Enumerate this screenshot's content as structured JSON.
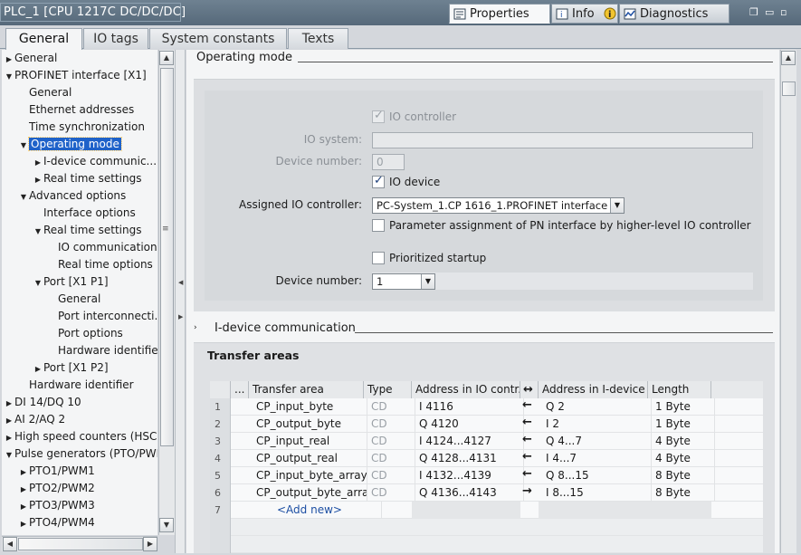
{
  "window": {
    "title": "PLC_1 [CPU 1217C DC/DC/DC]"
  },
  "inspector_tabs": [
    {
      "label": "Properties",
      "icon": "properties-icon",
      "active": true
    },
    {
      "label": "Info",
      "icon": "info-icon",
      "active": false
    },
    {
      "label": "Diagnostics",
      "icon": "diagnostics-icon",
      "active": false
    }
  ],
  "tabs": [
    {
      "label": "General",
      "active": true
    },
    {
      "label": "IO tags",
      "active": false
    },
    {
      "label": "System constants",
      "active": false
    },
    {
      "label": "Texts",
      "active": false
    }
  ],
  "nav": [
    {
      "label": "General",
      "level": 0,
      "arrow": "collapsed"
    },
    {
      "label": "PROFINET interface [X1]",
      "level": 0,
      "arrow": "expanded"
    },
    {
      "label": "General",
      "level": 1,
      "arrow": "none"
    },
    {
      "label": "Ethernet addresses",
      "level": 1,
      "arrow": "none"
    },
    {
      "label": "Time synchronization",
      "level": 1,
      "arrow": "none"
    },
    {
      "label": "Operating mode",
      "level": 1,
      "arrow": "expanded",
      "selected": true
    },
    {
      "label": "I-device communic...",
      "level": 2,
      "arrow": "collapsed"
    },
    {
      "label": "Real time settings",
      "level": 2,
      "arrow": "collapsed"
    },
    {
      "label": "Advanced options",
      "level": 1,
      "arrow": "expanded"
    },
    {
      "label": "Interface options",
      "level": 2,
      "arrow": "none"
    },
    {
      "label": "Real time settings",
      "level": 2,
      "arrow": "expanded"
    },
    {
      "label": "IO communication",
      "level": 3,
      "arrow": "none"
    },
    {
      "label": "Real time options",
      "level": 3,
      "arrow": "none"
    },
    {
      "label": "Port [X1 P1]",
      "level": 2,
      "arrow": "expanded"
    },
    {
      "label": "General",
      "level": 3,
      "arrow": "none"
    },
    {
      "label": "Port interconnecti...",
      "level": 3,
      "arrow": "none"
    },
    {
      "label": "Port options",
      "level": 3,
      "arrow": "none"
    },
    {
      "label": "Hardware identifier",
      "level": 3,
      "arrow": "none"
    },
    {
      "label": "Port [X1 P2]",
      "level": 2,
      "arrow": "collapsed"
    },
    {
      "label": "Hardware identifier",
      "level": 1,
      "arrow": "none"
    },
    {
      "label": "DI 14/DQ 10",
      "level": 0,
      "arrow": "collapsed"
    },
    {
      "label": "AI 2/AQ 2",
      "level": 0,
      "arrow": "collapsed"
    },
    {
      "label": "High speed counters (HSC)",
      "level": 0,
      "arrow": "collapsed"
    },
    {
      "label": "Pulse generators (PTO/PWM)",
      "level": 0,
      "arrow": "expanded"
    },
    {
      "label": "PTO1/PWM1",
      "level": 1,
      "arrow": "collapsed"
    },
    {
      "label": "PTO2/PWM2",
      "level": 1,
      "arrow": "collapsed"
    },
    {
      "label": "PTO3/PWM3",
      "level": 1,
      "arrow": "collapsed"
    },
    {
      "label": "PTO4/PWM4",
      "level": 1,
      "arrow": "collapsed"
    }
  ],
  "operating_mode": {
    "section_title": "Operating mode",
    "io_controller_label": "IO controller",
    "io_system_label": "IO system:",
    "io_system_value": "",
    "device_number_label_1": "Device number:",
    "device_number_value_1": "0",
    "io_device_label": "IO device",
    "assigned_io_controller_label": "Assigned IO controller:",
    "assigned_io_controller_value": "PC-System_1.CP 1616_1.PROFINET interface",
    "param_assign_label": "Parameter assignment of PN interface by higher-level IO controller",
    "prioritized_startup_label": "Prioritized startup",
    "device_number_label_2": "Device number:",
    "device_number_value_2": "1"
  },
  "idevice": {
    "section_title": "I-device communication",
    "transfer_areas_title": "Transfer areas",
    "columns": {
      "menu": "...",
      "transfer_area": "Transfer area",
      "type": "Type",
      "addr_io": "Address in IO contr...",
      "addr_idev": "Address in I-device",
      "length": "Length"
    },
    "rows": [
      {
        "num": "1",
        "name": "CP_input_byte",
        "type": "CD",
        "addr_io": "I 4116",
        "dir": "in",
        "addr_idev": "Q 2",
        "length": "1 Byte"
      },
      {
        "num": "2",
        "name": "CP_output_byte",
        "type": "CD",
        "addr_io": "Q 4120",
        "dir": "in",
        "addr_idev": "I 2",
        "length": "1 Byte"
      },
      {
        "num": "3",
        "name": "CP_input_real",
        "type": "CD",
        "addr_io": "I 4124...4127",
        "dir": "in",
        "addr_idev": "Q 4...7",
        "length": "4 Byte"
      },
      {
        "num": "4",
        "name": "CP_output_real",
        "type": "CD",
        "addr_io": "Q 4128...4131",
        "dir": "in",
        "addr_idev": "I 4...7",
        "length": "4 Byte"
      },
      {
        "num": "5",
        "name": "CP_input_byte_array",
        "type": "CD",
        "addr_io": "I 4132...4139",
        "dir": "in",
        "addr_idev": "Q 8...15",
        "length": "8 Byte"
      },
      {
        "num": "6",
        "name": "CP_output_byte_array",
        "type": "CD",
        "addr_io": "Q 4136...4143",
        "dir": "out",
        "addr_idev": "I 8...15",
        "length": "8 Byte"
      }
    ],
    "add_new_num": "7",
    "add_new_label": "<Add new>"
  }
}
